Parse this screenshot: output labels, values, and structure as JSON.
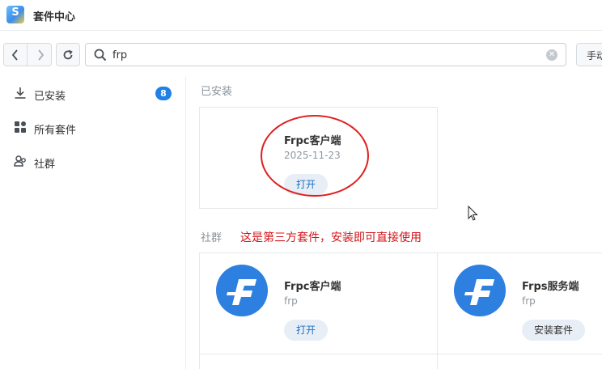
{
  "window": {
    "title": "套件中心",
    "app_icon": "package-center-icon"
  },
  "toolbar": {
    "search_value": "frp",
    "manual_button_label": "手动"
  },
  "sidebar": {
    "items": [
      {
        "label": "已安装",
        "icon": "download-icon",
        "badge": "8"
      },
      {
        "label": "所有套件",
        "icon": "grid-icon"
      },
      {
        "label": "社群",
        "icon": "community-icon"
      }
    ]
  },
  "installed": {
    "section_title": "已安装",
    "card": {
      "name": "Frpc客户端",
      "date": "2025-11-23",
      "button": "打开"
    }
  },
  "community": {
    "section_title": "社群",
    "annotation": "这是第三方套件，安装即可直接使用",
    "cards": [
      {
        "name": "Frpc客户端",
        "subtitle": "frp",
        "button": "打开"
      },
      {
        "name": "Frps服务端",
        "subtitle": "frp",
        "button": "安装套件"
      }
    ]
  },
  "colors": {
    "accent": "#1f80e6",
    "annotation": "#e01e1e",
    "logo": "#2d7fe0"
  }
}
